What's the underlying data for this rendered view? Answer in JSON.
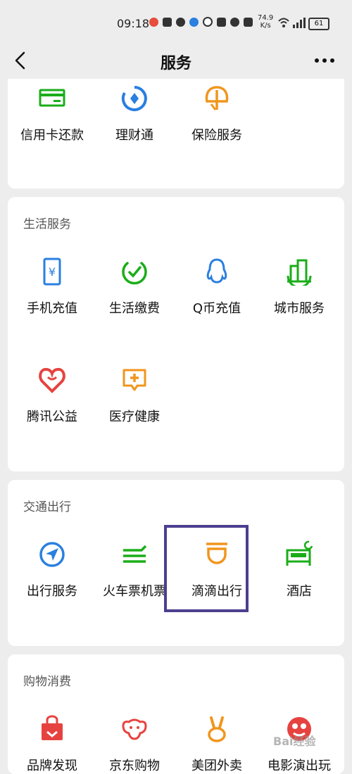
{
  "status_bar": {
    "time": "09:18",
    "net_speed": "74.9",
    "net_unit": "K/s",
    "battery": "61"
  },
  "header": {
    "title": "服务"
  },
  "finance": {
    "items": [
      {
        "label": "信用卡还款",
        "icon": "credit-card-icon",
        "color": "#1aad19"
      },
      {
        "label": "理财通",
        "icon": "wealth-icon",
        "color": "#2a7fe0"
      },
      {
        "label": "保险服务",
        "icon": "umbrella-icon",
        "color": "#f0961e"
      }
    ]
  },
  "life": {
    "title": "生活服务",
    "items": [
      {
        "label": "手机充值",
        "icon": "phone-recharge-icon",
        "color": "#2a7fe0"
      },
      {
        "label": "生活缴费",
        "icon": "utility-payment-icon",
        "color": "#1aad19"
      },
      {
        "label": "Q币充值",
        "icon": "qq-coin-icon",
        "color": "#2a7fe0"
      },
      {
        "label": "城市服务",
        "icon": "city-service-icon",
        "color": "#1aad19"
      },
      {
        "label": "腾讯公益",
        "icon": "charity-heart-icon",
        "color": "#e64340"
      },
      {
        "label": "医疗健康",
        "icon": "medical-icon",
        "color": "#f0961e"
      }
    ]
  },
  "transport": {
    "title": "交通出行",
    "items": [
      {
        "label": "出行服务",
        "icon": "navigation-icon",
        "color": "#2a7fe0"
      },
      {
        "label": "火车票机票",
        "icon": "train-icon",
        "color": "#1aad19"
      },
      {
        "label": "滴滴出行",
        "icon": "didi-icon",
        "color": "#f0961e"
      },
      {
        "label": "酒店",
        "icon": "hotel-bed-icon",
        "color": "#1aad19"
      }
    ]
  },
  "shopping": {
    "title": "购物消费",
    "items": [
      {
        "label": "品牌发现",
        "icon": "brand-bag-icon",
        "color": "#e64340"
      },
      {
        "label": "京东购物",
        "icon": "jd-dog-icon",
        "color": "#e64340"
      },
      {
        "label": "美团外卖",
        "icon": "meituan-rabbit-icon",
        "color": "#f0961e"
      },
      {
        "label": "电影演出玩",
        "icon": "movie-icon",
        "color": "#e64340"
      }
    ]
  },
  "watermark": "Bai经验"
}
